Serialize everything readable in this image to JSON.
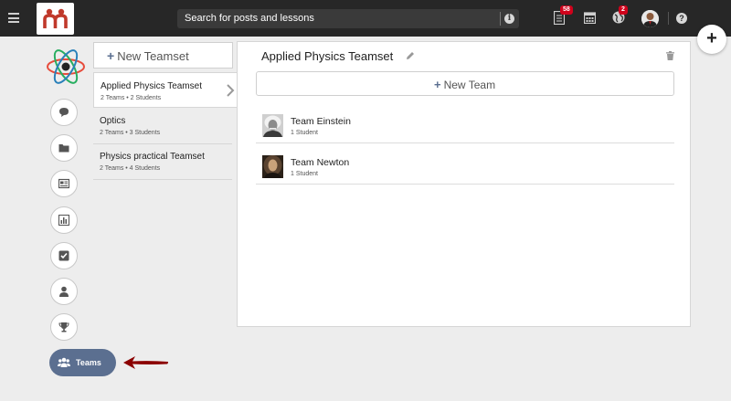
{
  "header": {
    "search_placeholder": "Search for posts and lessons",
    "notifications_badge": "58",
    "globe_badge": "2",
    "help_label": "?"
  },
  "sidebar": {
    "teams_label": "Teams"
  },
  "teamsets": {
    "new_label": "New Teamset",
    "items": [
      {
        "name": "Applied Physics Teamset",
        "meta": "2 Teams • 2 Students"
      },
      {
        "name": "Optics",
        "meta": "2 Teams • 3 Students"
      },
      {
        "name": "Physics practical Teamset",
        "meta": "2 Teams • 4 Students"
      }
    ]
  },
  "panel": {
    "title": "Applied Physics Teamset",
    "new_team_label": "New Team",
    "teams": [
      {
        "name": "Team Einstein",
        "meta": "1 Student"
      },
      {
        "name": "Team Newton",
        "meta": "1 Student"
      }
    ]
  },
  "colors": {
    "accent": "#5b6f90",
    "topbar": "#272727",
    "badge": "#d0021b",
    "logo": "#c0392b",
    "arrow": "#8b0000"
  }
}
